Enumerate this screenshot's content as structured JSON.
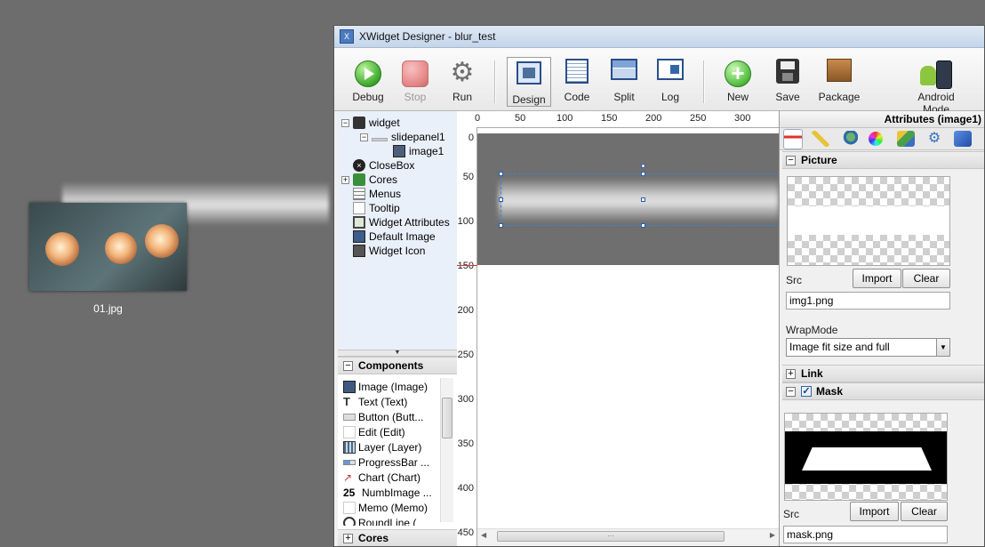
{
  "desktop": {
    "file_label": "01.jpg"
  },
  "window": {
    "title": "XWidget Designer - blur_test"
  },
  "toolbar": {
    "debug": "Debug",
    "stop": "Stop",
    "run": "Run",
    "design": "Design",
    "code": "Code",
    "split": "Split",
    "log": "Log",
    "new": "New",
    "save": "Save",
    "package": "Package",
    "android_mode": "Android Mode"
  },
  "tree": {
    "items": [
      "widget",
      "slidepanel1",
      "image1",
      "CloseBox",
      "Cores",
      "Menus",
      "Tooltip",
      "Widget Attributes",
      "Default Image",
      "Widget Icon"
    ]
  },
  "components": {
    "title": "Components",
    "items": [
      "Image (Image)",
      "Text (Text)",
      "Button (Butt...",
      "Edit (Edit)",
      "Layer (Layer)",
      "ProgressBar ...",
      "Chart (Chart)",
      "NumbImage ...",
      "Memo (Memo)",
      "RoundLine ("
    ]
  },
  "cores": {
    "title": "Cores"
  },
  "ruler": {
    "top": [
      "0",
      "50",
      "100",
      "150",
      "200",
      "250",
      "300"
    ],
    "left": [
      "0",
      "50",
      "100",
      "150",
      "200",
      "250",
      "300",
      "350",
      "400",
      "450"
    ]
  },
  "attributes": {
    "title": "Attributes (image1)",
    "picture": {
      "title": "Picture",
      "src_label": "Src",
      "import": "Import",
      "clear": "Clear",
      "src_value": "img1.png",
      "wrap_label": "WrapMode",
      "wrap_value": "Image fit size and full"
    },
    "link": {
      "title": "Link"
    },
    "mask": {
      "title": "Mask",
      "src_label": "Src",
      "import": "Import",
      "clear": "Clear",
      "src_value": "mask.png"
    }
  },
  "colors": {
    "canvas_panel": "#6f6f6f",
    "selection": "#3f82d6",
    "ruler_marker": "#dd3333"
  }
}
